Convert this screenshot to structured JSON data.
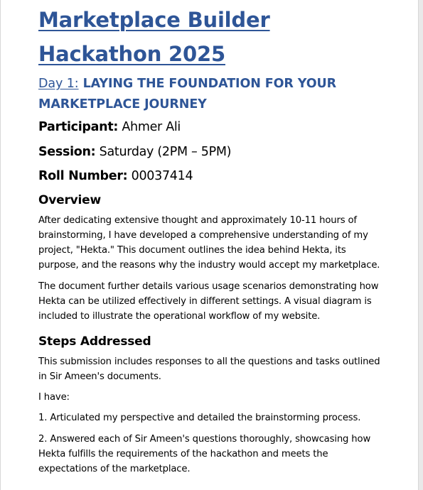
{
  "document": {
    "title": "Marketplace Builder Hackathon 2025",
    "day": {
      "label": "Day 1:",
      "heading": "LAYING THE FOUNDATION FOR YOUR MARKETPLACE JOURNEY"
    },
    "participant": {
      "label": "Participant:",
      "value": "Ahmer Ali"
    },
    "session": {
      "label": "Session:",
      "value": "Saturday (2PM – 5PM)"
    },
    "roll_number": {
      "label": "Roll Number:",
      "value": "00037414"
    },
    "overview": {
      "heading": "Overview",
      "paragraphs": [
        "After dedicating extensive thought and approximately 10-11 hours of brainstorming, I have developed a comprehensive understanding of my project, \"Hekta.\" This document outlines the idea behind Hekta, its purpose, and the reasons why the industry would accept my marketplace.",
        "The document further details various usage scenarios demonstrating how Hekta can be utilized effectively in different settings. A visual diagram is included to illustrate the operational workflow of my website."
      ]
    },
    "steps": {
      "heading": "Steps Addressed",
      "paragraphs": [
        "This submission includes responses to all the questions and tasks outlined in Sir Ameen's documents.",
        "I have:",
        "1. Articulated my perspective and detailed the brainstorming process.",
        "2. Answered each of Sir Ameen's questions thoroughly, showcasing how Hekta fulfills the requirements of the hackathon and meets the expectations of the marketplace."
      ]
    }
  }
}
